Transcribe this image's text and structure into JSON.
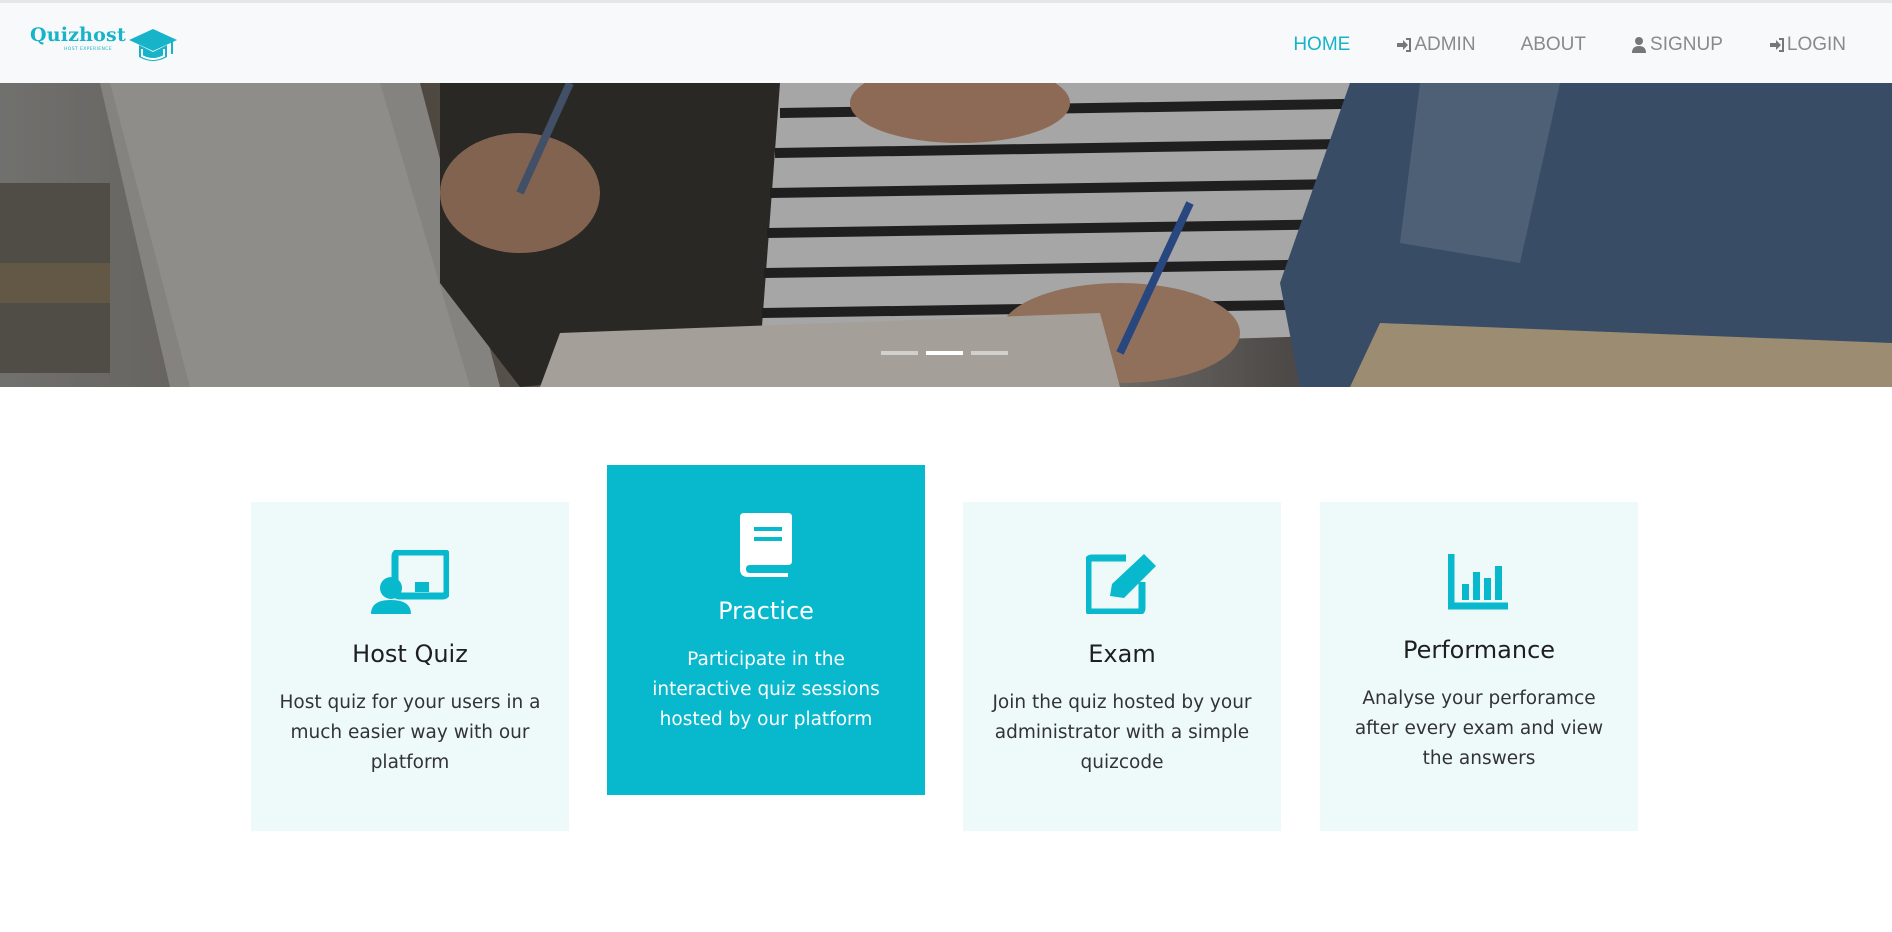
{
  "navbar": {
    "brand_name": "Quizhost",
    "brand_tagline": "HOST EXPERIENCE",
    "items": [
      {
        "label": "HOME",
        "active": true
      },
      {
        "label": "ADMIN",
        "icon": "sign-in-icon"
      },
      {
        "label": "ABOUT"
      },
      {
        "label": "SIGNUP",
        "icon": "user-icon"
      },
      {
        "label": "LOGIN",
        "icon": "sign-in-icon"
      }
    ]
  },
  "hero": {
    "slides_count": 3,
    "active_slide": 2,
    "image_description": "students studying with laptop and notebooks"
  },
  "features": [
    {
      "title": "Host Quiz",
      "icon": "presentation-icon",
      "text": "Host quiz for your users in a much easier way with our platform"
    },
    {
      "title": "Practice",
      "icon": "book-icon",
      "text": "Participate in the interactive quiz sessions hosted by our platform",
      "highlighted": true
    },
    {
      "title": "Exam",
      "icon": "edit-icon",
      "text": "Join the quiz hosted by your administrator with a simple quizcode"
    },
    {
      "title": "Performance",
      "icon": "bar-chart-icon",
      "text": "Analyse your perforamce after every exam and view the answers"
    }
  ],
  "colors": {
    "accent": "#08b8cc",
    "nav_text": "#8a8a8a",
    "card_bg": "#eefafa"
  }
}
